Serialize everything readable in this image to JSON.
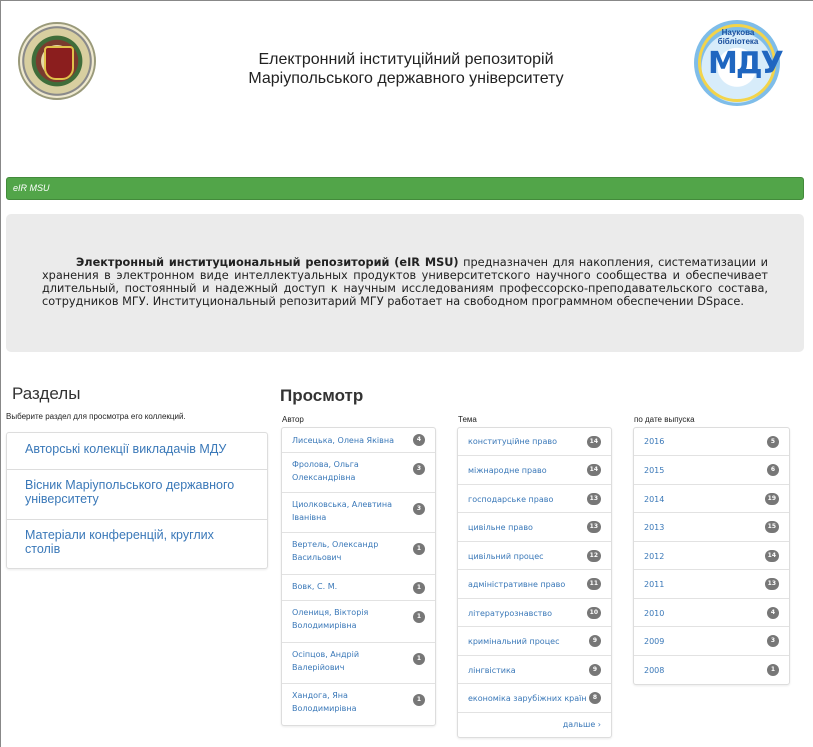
{
  "header": {
    "title": "Електронний інституційний репозиторій Маріупольського державного університету",
    "right_logo_text": "МДУ",
    "right_logo_arc": "Наукова бібліотека"
  },
  "trail": {
    "label": "eIR MSU"
  },
  "intro": {
    "bold": "Электронный институциональный репозиторий (eIR MSU)",
    "text": " предназначен для накопления, систематизации и хранения в электронном виде интеллектуальных продуктов университетского научного сообщества и обеспечивает длительный, постоянный и надежный доступ к научным исследованиям профессорско-преподавательского состава, сотрудников МГУ. Институциональный репозитарий МГУ работает на свободном программном обеспечении DSpace."
  },
  "sections": {
    "heading": "Разделы",
    "subtitle": "Выберите раздел для просмотра его коллекций.",
    "items": [
      {
        "label": "Авторські колекції викладачів МДУ"
      },
      {
        "label": "Вісник Маріупольського державного університету"
      },
      {
        "label": "Матеріали конференцій, круглих столів"
      }
    ]
  },
  "browse": {
    "heading": "Просмотр",
    "author": {
      "label": "Автор",
      "items": [
        {
          "label": "Лисецька, Олена Яківна",
          "count": "4"
        },
        {
          "label": "Фролова, Ольга Олександрівна",
          "count": "3"
        },
        {
          "label": "Циолковська, Алевтина Іванівна",
          "count": "3"
        },
        {
          "label": "Вертель, Олександр Васильович",
          "count": "1"
        },
        {
          "label": "Вовк, С. М.",
          "count": "1"
        },
        {
          "label": "Олениця, Вікторія Володимирівна",
          "count": "1"
        },
        {
          "label": "Осіпцов, Андрій Валерійович",
          "count": "1"
        },
        {
          "label": "Хандога, Яна Володимирівна",
          "count": "1"
        }
      ]
    },
    "subject": {
      "label": "Тема",
      "items": [
        {
          "label": "конституційне право",
          "count": "14"
        },
        {
          "label": "міжнародне право",
          "count": "14"
        },
        {
          "label": "господарське право",
          "count": "13"
        },
        {
          "label": "цивільне право",
          "count": "13"
        },
        {
          "label": "цивільний процес",
          "count": "12"
        },
        {
          "label": "адміністративне право",
          "count": "11"
        },
        {
          "label": "літературознавство",
          "count": "10"
        },
        {
          "label": "кримінальний процес",
          "count": "9"
        },
        {
          "label": "лінгвістика",
          "count": "9"
        },
        {
          "label": "економіка зарубіжних країн",
          "count": "8"
        }
      ],
      "more": "дальше ›"
    },
    "date": {
      "label": "по дате выпуска",
      "items": [
        {
          "label": "2016",
          "count": "5"
        },
        {
          "label": "2015",
          "count": "6"
        },
        {
          "label": "2014",
          "count": "19"
        },
        {
          "label": "2013",
          "count": "15"
        },
        {
          "label": "2012",
          "count": "14"
        },
        {
          "label": "2011",
          "count": "13"
        },
        {
          "label": "2010",
          "count": "4"
        },
        {
          "label": "2009",
          "count": "3"
        },
        {
          "label": "2008",
          "count": "1"
        }
      ]
    }
  }
}
